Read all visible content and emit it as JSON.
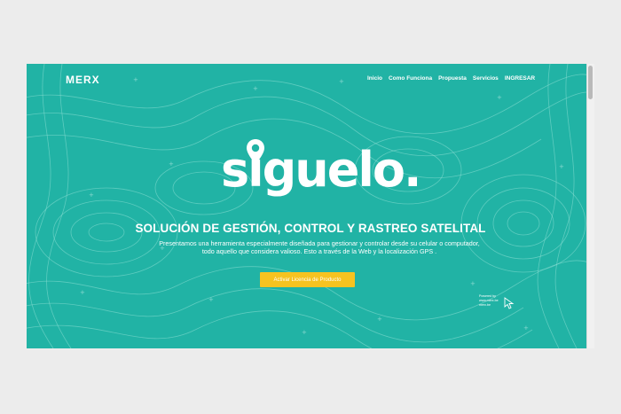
{
  "header": {
    "logo_text": "MERX",
    "nav": [
      "Inicio",
      "Como Funciona",
      "Propuesta",
      "Servicios",
      "INGRESAR"
    ]
  },
  "hero": {
    "brand": "siguelo.",
    "headline": "SOLUCIÓN DE GESTIÓN, CONTROL Y RASTREO SATELITAL",
    "description_line1": "Presentamos una herramienta especialmente diseñada para gestionar y controlar desde su celular o computador,",
    "description_line2": "todo aquello que considera valioso. Esto a través de la Web y la localización GPS .",
    "cta_label": "Activar Licencia de Producto"
  },
  "powered_badge": {
    "line1": "Powered by",
    "line2": "www.merx.be",
    "line3": "merx.be"
  },
  "colors": {
    "background": "#21b3a5",
    "accent_button": "#f6c320",
    "text": "#ffffff",
    "page_outer": "#ececec"
  }
}
